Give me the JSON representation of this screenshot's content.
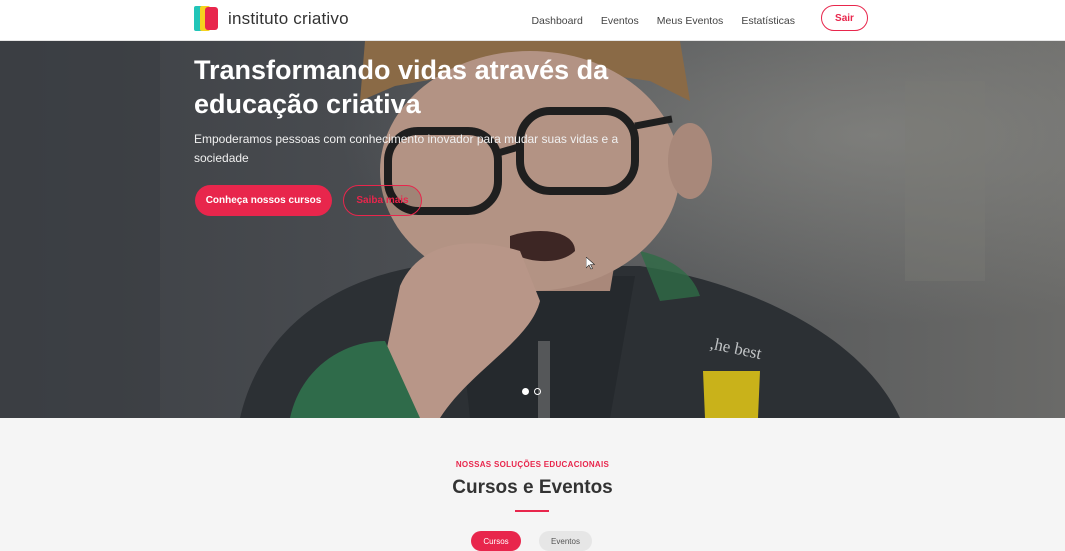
{
  "brand": {
    "name": "instituto criativo",
    "logo_icon": "logo-icon"
  },
  "nav": {
    "items": [
      "Dashboard",
      "Eventos",
      "Meus Eventos",
      "Estatísticas"
    ],
    "logout": "Sair"
  },
  "hero": {
    "title": "Transformando vidas através da educação criativa",
    "subtitle": "Empoderamos pessoas com conhecimento inovador para mudar suas vidas e a sociedade",
    "primary_button": "Conheça nossos cursos",
    "secondary_button": "Saiba mais",
    "slides": {
      "count": 2,
      "active": 1
    }
  },
  "section": {
    "eyebrow": "NOSSAS SOLUÇÕES EDUCACIONAIS",
    "title": "Cursos e Eventos",
    "tabs": [
      {
        "label": "Cursos",
        "active": true
      },
      {
        "label": "Eventos",
        "active": false
      }
    ]
  },
  "colors": {
    "accent": "#e8264c",
    "teal": "#21c5b8",
    "yellow": "#f6d21e"
  }
}
